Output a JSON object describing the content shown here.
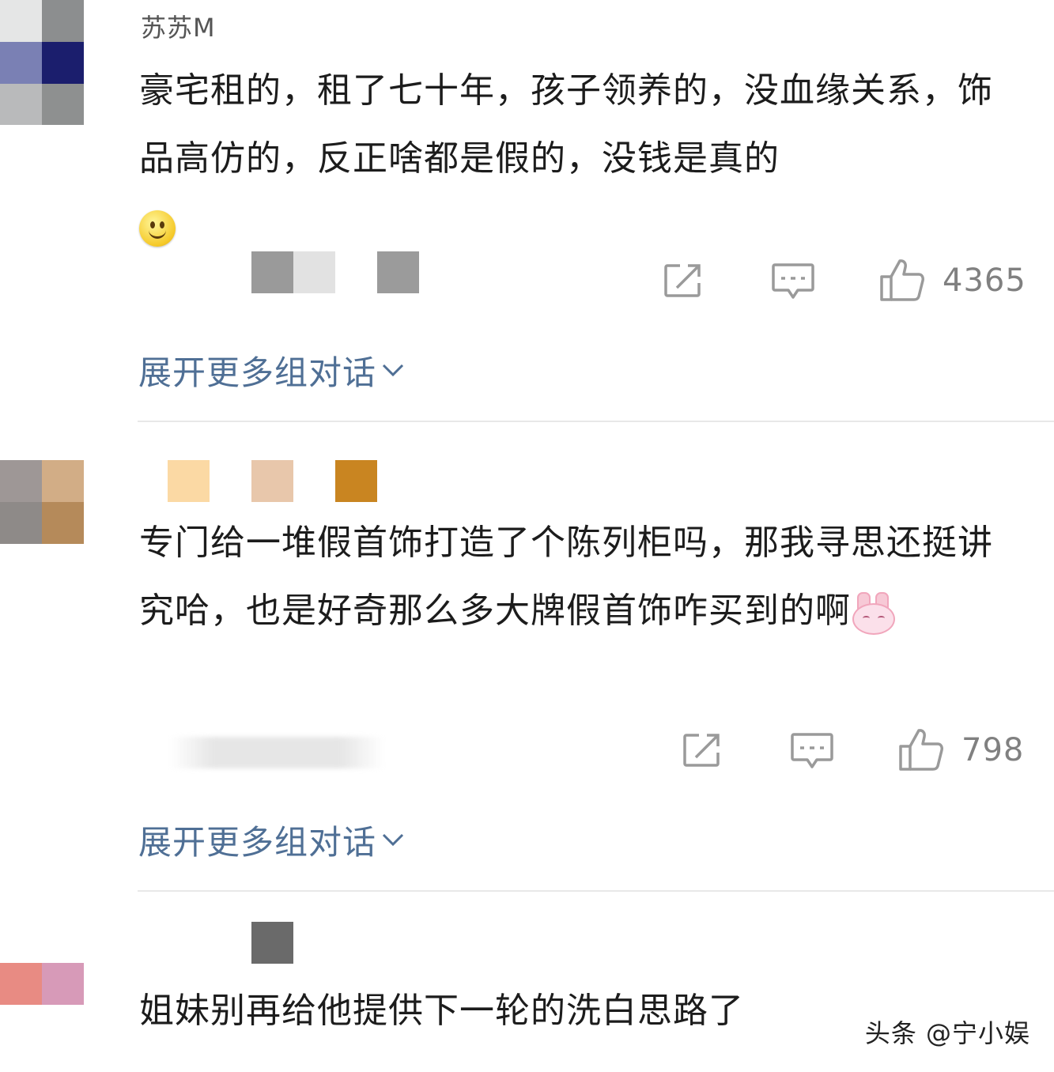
{
  "comments": [
    {
      "username": "苏苏M",
      "text": "豪宅租的，租了七十年，孩子领养的，没血缘关系，饰品高仿的，反正啥都是假的，没钱是真的",
      "emoji": "smile-emoji",
      "likes": "4365",
      "expand_label": "展开更多组对话"
    },
    {
      "username": "",
      "text": "专门给一堆假首饰打造了个陈列柜吗，那我寻思还挺讲究哈，也是好奇那么多大牌假首饰咋买到的啊",
      "emoji": "bunny-emoji",
      "likes": "798",
      "expand_label": "展开更多组对话"
    },
    {
      "username": "",
      "text": "姐妹别再给他提供下一轮的洗白思路了"
    }
  ],
  "watermark": "头条 @宁小娱",
  "colors": {
    "link": "#4f6f95",
    "icon": "#9a9a9a",
    "divider": "#e8e8e8"
  }
}
